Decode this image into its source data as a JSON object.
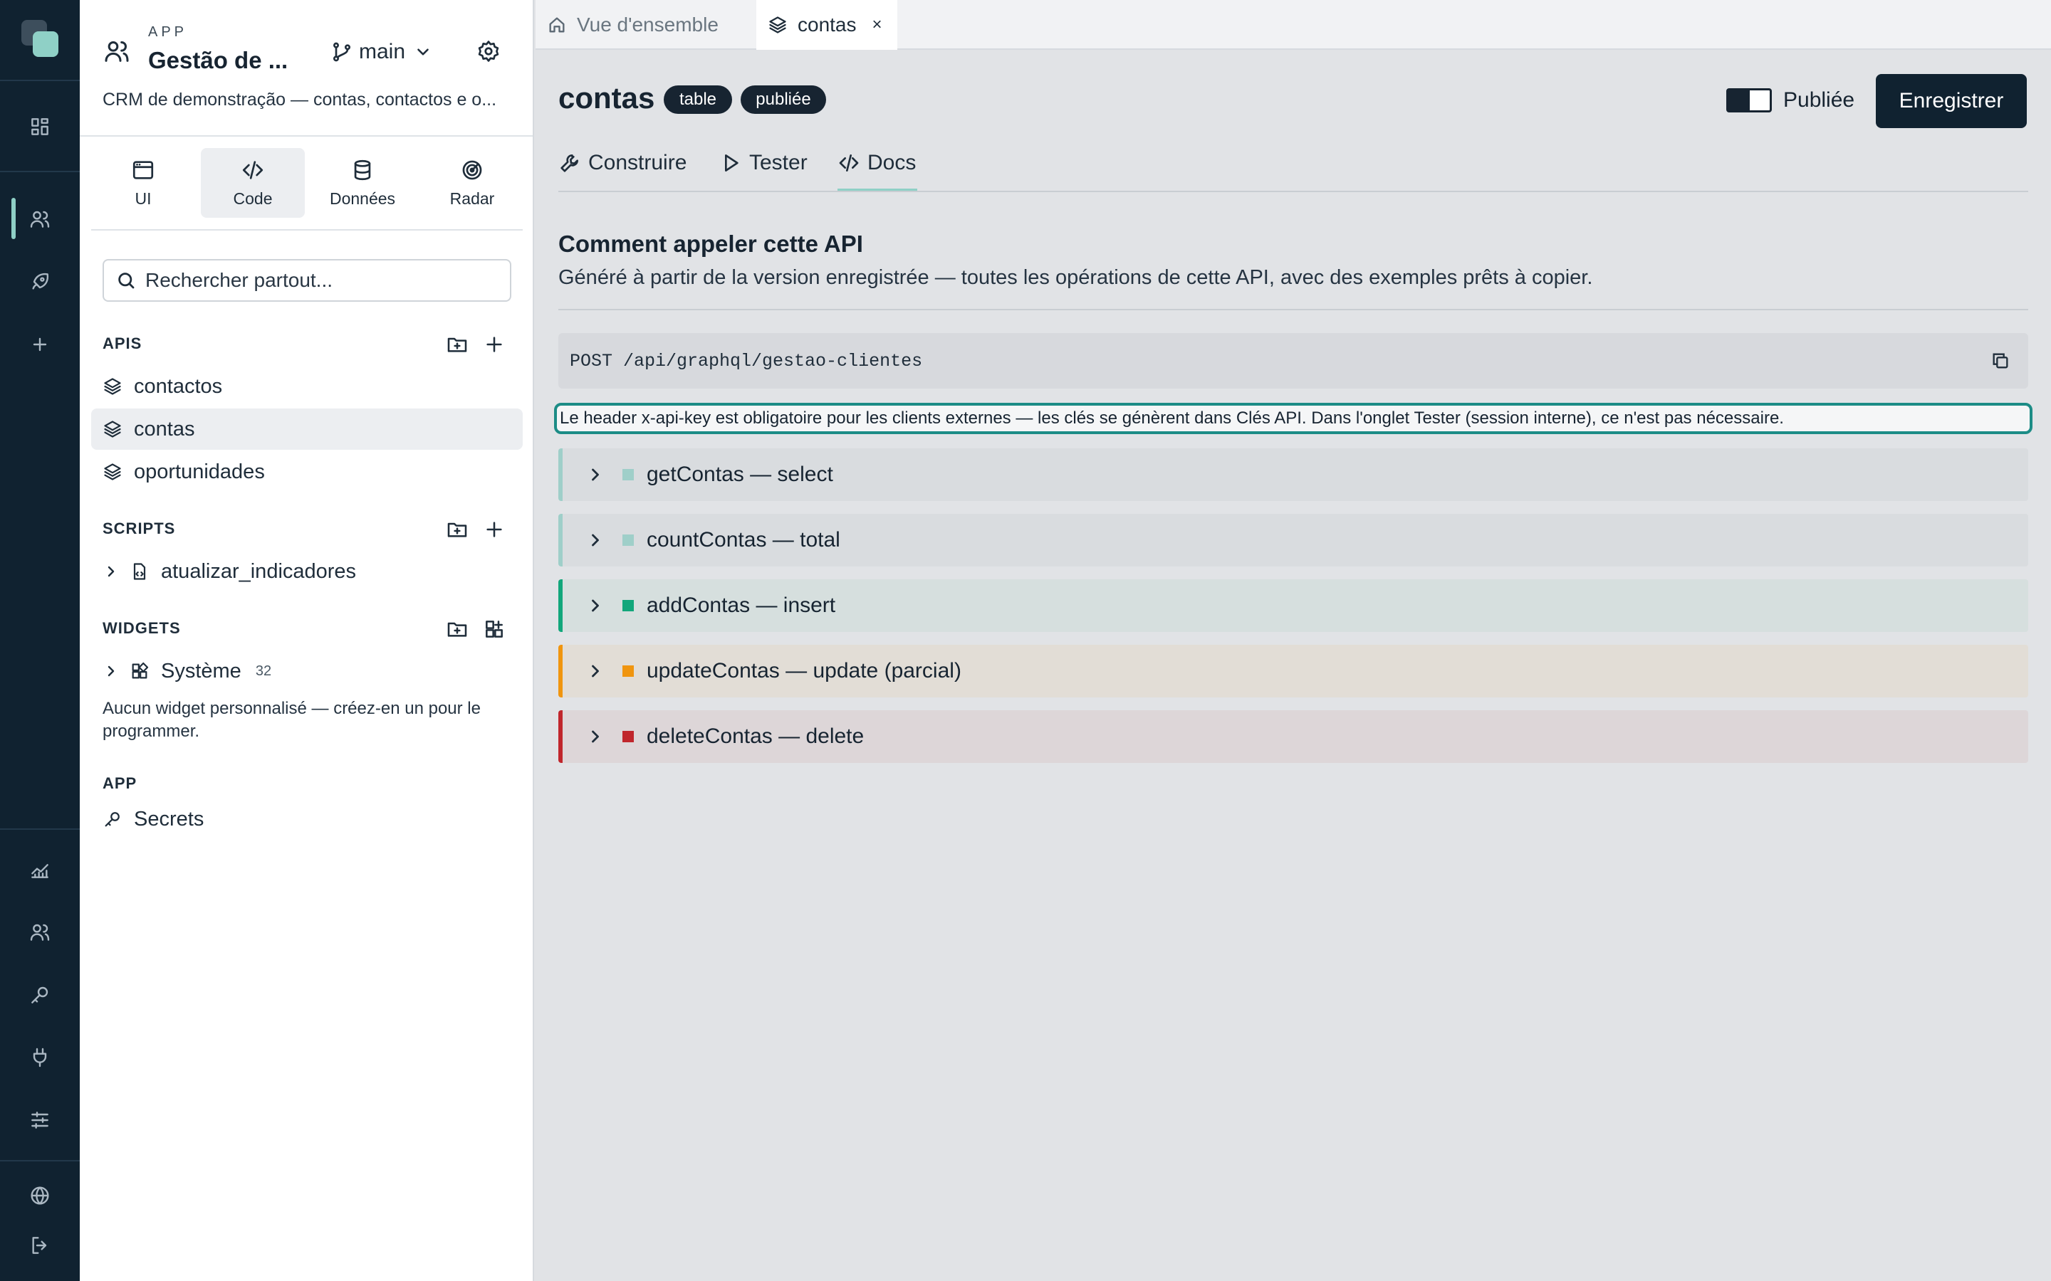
{
  "sidebar": {
    "eyebrow": "APP",
    "app_name": "Gestão de ...",
    "branch": "main",
    "description": "CRM de demonstração — contas, contactos e o...",
    "tools": [
      {
        "label": "UI",
        "icon": "browser-window-icon"
      },
      {
        "label": "Code",
        "icon": "code-icon"
      },
      {
        "label": "Données",
        "icon": "database-icon"
      },
      {
        "label": "Radar",
        "icon": "radar-icon"
      }
    ],
    "search_placeholder": "Rechercher partout...",
    "sections": {
      "apis": {
        "title": "APIS",
        "items": [
          "contactos",
          "contas",
          "oportunidades"
        ]
      },
      "scripts": {
        "title": "SCRIPTS",
        "items": [
          "atualizar_indicadores"
        ]
      },
      "widgets": {
        "title": "WIDGETS",
        "group": "Système",
        "count": "32",
        "empty_note": "Aucun widget personnalisé — créez-en un pour le programmer."
      },
      "app": {
        "title": "APP",
        "items": [
          "Secrets"
        ]
      }
    }
  },
  "tabs": [
    {
      "label": "Vue d'ensemble",
      "icon": "home-icon"
    },
    {
      "label": "contas",
      "icon": "layers-icon",
      "close": "×"
    }
  ],
  "main": {
    "title": "contas",
    "badges": [
      "table",
      "publiée"
    ],
    "toggle_label": "Publiée",
    "save_label": "Enregistrer",
    "subtabs": [
      "Construire",
      "Tester",
      "Docs"
    ],
    "active_subtab": "Docs",
    "heading": "Comment appeler cette API",
    "lead": "Généré à partir de la version enregistrée — toutes les opérations de cette API, avec des exemples prêts à copier.",
    "endpoint": "POST /api/graphql/gestao-clientes",
    "note": "Le header x-api-key est obligatoire pour les clients externes — les clés se génèrent dans Clés API. Dans l'onglet Tester (session interne), ce n'est pas nécessaire.",
    "operations": [
      {
        "label": "getContas — select",
        "accent": "#9fcfc9",
        "bg": "#d9dcdf",
        "marker": "#9fcfc9"
      },
      {
        "label": "countContas — total",
        "accent": "#9fcfc9",
        "bg": "#d9dcdf",
        "marker": "#9fcfc9"
      },
      {
        "label": "addContas — insert",
        "accent": "#12a77b",
        "bg": "#d6dfde",
        "marker": "#12a77b"
      },
      {
        "label": "updateContas — update (parcial)",
        "accent": "#f0950f",
        "bg": "#e2ddd6",
        "marker": "#f0950f"
      },
      {
        "label": "deleteContas — delete",
        "accent": "#c0262c",
        "bg": "#ddd6d8",
        "marker": "#c0262c"
      }
    ]
  },
  "colors": {
    "rail": "#102230",
    "accent": "#8fd0c6",
    "highlight": "#1c8c86"
  }
}
